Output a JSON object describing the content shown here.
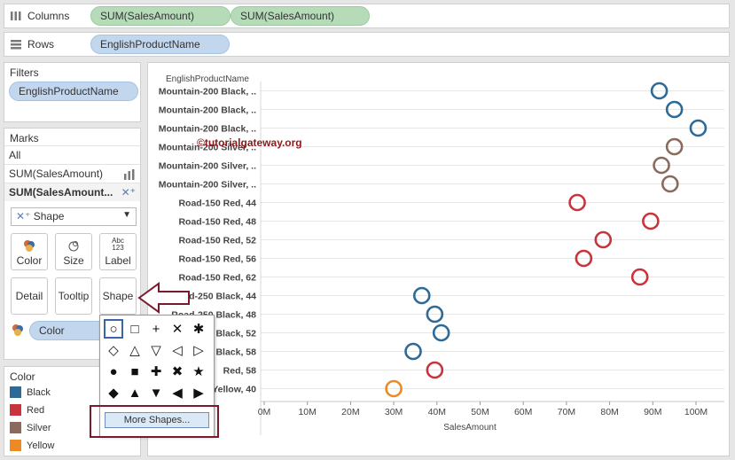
{
  "shelves": {
    "columns": {
      "label": "Columns",
      "pills": [
        "SUM(SalesAmount)",
        "SUM(SalesAmount)"
      ]
    },
    "rows": {
      "label": "Rows",
      "pills": [
        "EnglishProductName"
      ]
    }
  },
  "filters": {
    "title": "Filters",
    "pill": "EnglishProductName"
  },
  "marks": {
    "title": "Marks",
    "tabs": [
      "All",
      "SUM(SalesAmount)",
      "SUM(SalesAmount..."
    ],
    "mark_type": "Shape",
    "buttons": {
      "color": "Color",
      "size": "Size",
      "label": "Label",
      "label_icon_text": "Abc\n123",
      "detail": "Detail",
      "tooltip": "Tooltip",
      "shape": "Shape"
    },
    "color_pill": "Color"
  },
  "color_legend": {
    "title": "Color",
    "items": [
      {
        "label": "Black",
        "color": "#2e6a96"
      },
      {
        "label": "Red",
        "color": "#c9343c"
      },
      {
        "label": "Silver",
        "color": "#8a6a5c"
      },
      {
        "label": "Yellow",
        "color": "#ee8a24"
      }
    ]
  },
  "shape_palette": {
    "rows": [
      [
        "circle-open",
        "square-open",
        "plus",
        "cross",
        "asterisk"
      ],
      [
        "diamond-open",
        "triangle-up-open",
        "triangle-down-open",
        "triangle-left-open",
        "triangle-right-open"
      ],
      [
        "circle-filled",
        "square-filled",
        "plus-bold",
        "cross-bold",
        "star-filled"
      ],
      [
        "diamond-filled",
        "triangle-up-filled",
        "triangle-down-filled",
        "triangle-left-filled",
        "triangle-right-filled"
      ]
    ],
    "selected": "circle-open",
    "more_label": "More Shapes..."
  },
  "watermark": "©tutorialgateway.org",
  "chart_data": {
    "type": "scatter",
    "row_header": "EnglishProductName",
    "xlabel": "SalesAmount",
    "xlim": [
      0,
      100
    ],
    "x_ticks": [
      "0M",
      "10M",
      "20M",
      "30M",
      "40M",
      "50M",
      "60M",
      "70M",
      "80M",
      "90M",
      "100M"
    ],
    "categories": [
      "Mountain-200 Black, ..",
      "Mountain-200 Black, ..",
      "Mountain-200 Black, ..",
      "Mountain-200 Silver, ..",
      "Mountain-200 Silver, ..",
      "Mountain-200 Silver, ..",
      "Road-150 Red, 44",
      "Road-150 Red, 48",
      "Road-150 Red, 52",
      "Road-150 Red, 56",
      "Road-150 Red, 62",
      "Road-250 Black, 44",
      "Road-250 Black, 48",
      "Road-250 Black, 52",
      "Road-250 Black, 58",
      "Road-250 Red, 58",
      "Road-650 Yellow, 40"
    ],
    "visible_labels": [
      "Mountain-200 Black, ..",
      "Mountain-200 Black, ..",
      "Mountain-200 Black, ..",
      "Mountain-200 Silver, ..",
      "Mountain-200 Silver, ..",
      "Mountain-200 Silver, ..",
      "Road-150 Red, 44",
      "Road-150 Red, 48",
      "Road-150 Red, 52",
      "Road-150 Red, 56",
      "Road-150 Red, 62",
      "Road-250 Black, 44",
      "Road-250 Black, 48",
      "Black, 52",
      "Black, 58",
      "Red, 58",
      "Yellow, 40"
    ],
    "values": [
      91.5,
      95,
      100.5,
      95,
      92,
      94,
      72.5,
      89.5,
      78.5,
      74,
      87,
      36.5,
      39.5,
      41,
      34.5,
      39.5,
      30
    ],
    "colors": [
      "Black",
      "Black",
      "Black",
      "Silver",
      "Silver",
      "Silver",
      "Red",
      "Red",
      "Red",
      "Red",
      "Red",
      "Black",
      "Black",
      "Black",
      "Black",
      "Red",
      "Yellow"
    ],
    "shape": "circle-open",
    "grid": true
  }
}
